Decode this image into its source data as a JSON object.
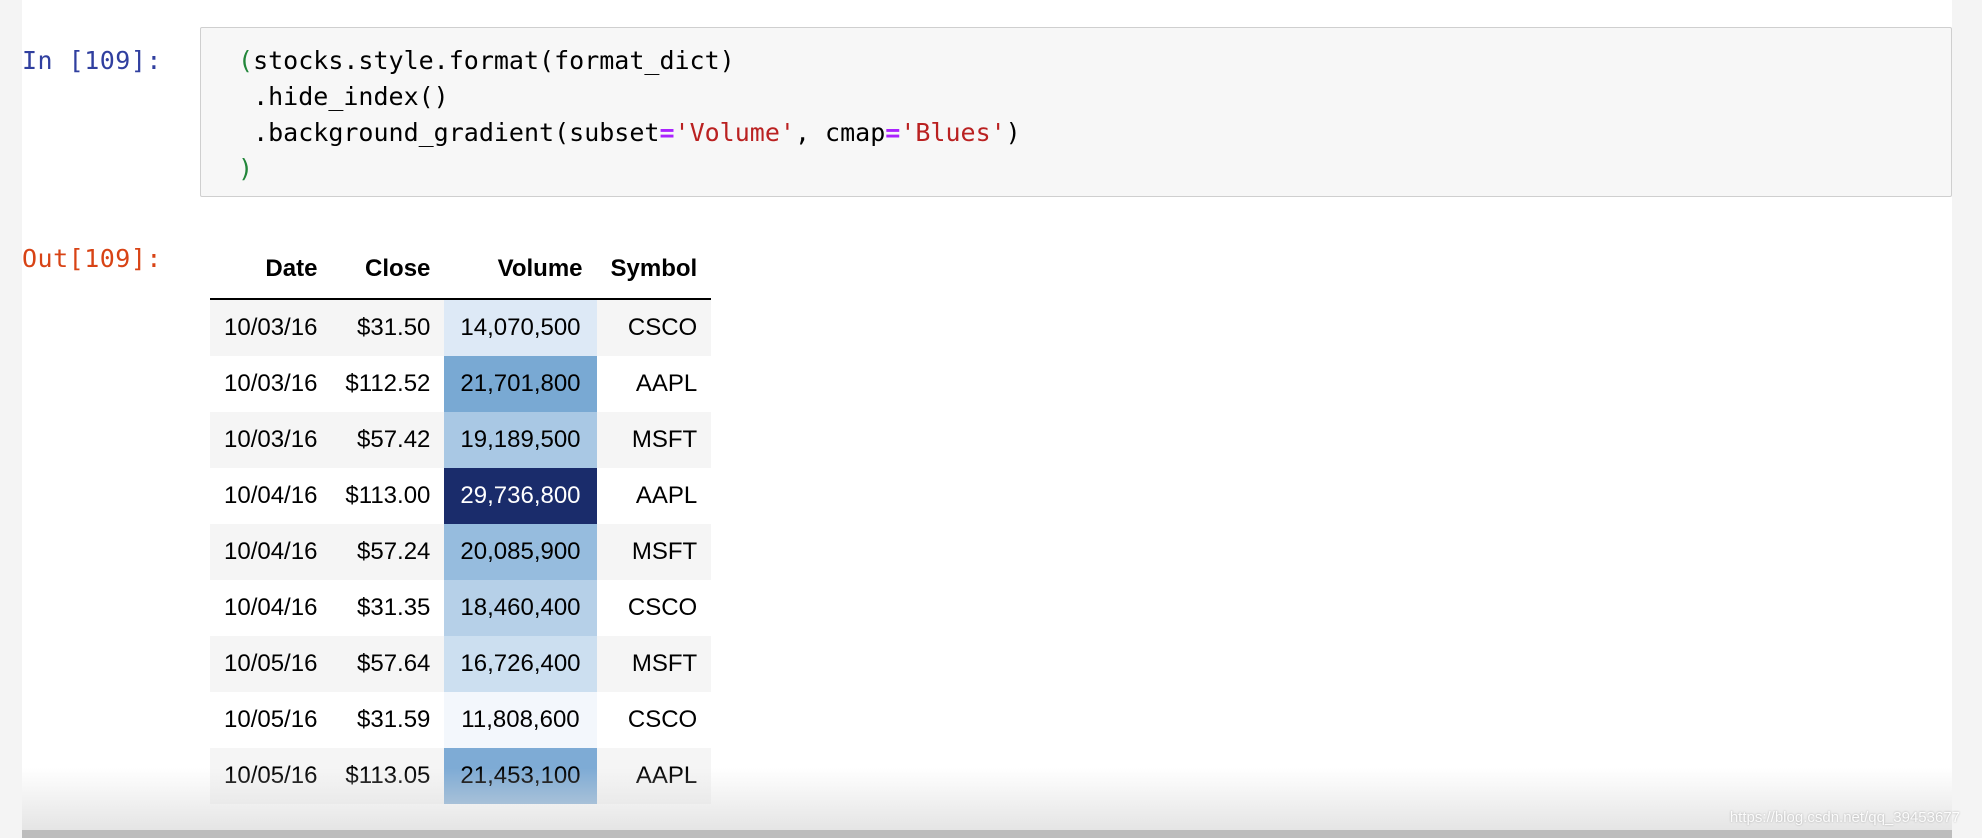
{
  "cell": {
    "in_prompt": "In [109]:",
    "out_prompt": "Out[109]:",
    "code": {
      "line1": {
        "p": "(",
        "text": "stocks.style.format(format_dict)"
      },
      "line2": {
        "text": ".hide_index()"
      },
      "line3": {
        "pre": ".background_gradient(subset",
        "eq1": "=",
        "str1": "'Volume'",
        "mid": ", cmap",
        "eq2": "=",
        "str2": "'Blues'",
        "post": ")"
      },
      "line4": {
        "p": ")"
      }
    }
  },
  "table": {
    "columns": [
      "Date",
      "Close",
      "Volume",
      "Symbol"
    ],
    "rows": [
      {
        "date": "10/03/16",
        "close": "$31.50",
        "volume": "14,070,500",
        "symbol": "CSCO",
        "bg": "#dde9f6",
        "fg": "#000000"
      },
      {
        "date": "10/03/16",
        "close": "$112.52",
        "volume": "21,701,800",
        "symbol": "AAPL",
        "bg": "#79a9d3",
        "fg": "#000000"
      },
      {
        "date": "10/03/16",
        "close": "$57.42",
        "volume": "19,189,500",
        "symbol": "MSFT",
        "bg": "#a9c8e4",
        "fg": "#000000"
      },
      {
        "date": "10/04/16",
        "close": "$113.00",
        "volume": "29,736,800",
        "symbol": "AAPL",
        "bg": "#1a2c6b",
        "fg": "#ffffff"
      },
      {
        "date": "10/04/16",
        "close": "$57.24",
        "volume": "20,085,900",
        "symbol": "MSFT",
        "bg": "#96bcde",
        "fg": "#000000"
      },
      {
        "date": "10/04/16",
        "close": "$31.35",
        "volume": "18,460,400",
        "symbol": "CSCO",
        "bg": "#b6d0e8",
        "fg": "#000000"
      },
      {
        "date": "10/05/16",
        "close": "$57.64",
        "volume": "16,726,400",
        "symbol": "MSFT",
        "bg": "#ccdff0",
        "fg": "#000000"
      },
      {
        "date": "10/05/16",
        "close": "$31.59",
        "volume": "11,808,600",
        "symbol": "CSCO",
        "bg": "#f3f7fc",
        "fg": "#000000"
      },
      {
        "date": "10/05/16",
        "close": "$113.05",
        "volume": "21,453,100",
        "symbol": "AAPL",
        "bg": "#7eabd5",
        "fg": "#000000"
      }
    ]
  },
  "watermark": "https://blog.csdn.net/qq_39453677",
  "colors": {
    "in_prompt": "#303f9f",
    "out_prompt": "#d84315",
    "string": "#ba2121",
    "operator": "#aa22ff",
    "paren": "#22863a"
  }
}
